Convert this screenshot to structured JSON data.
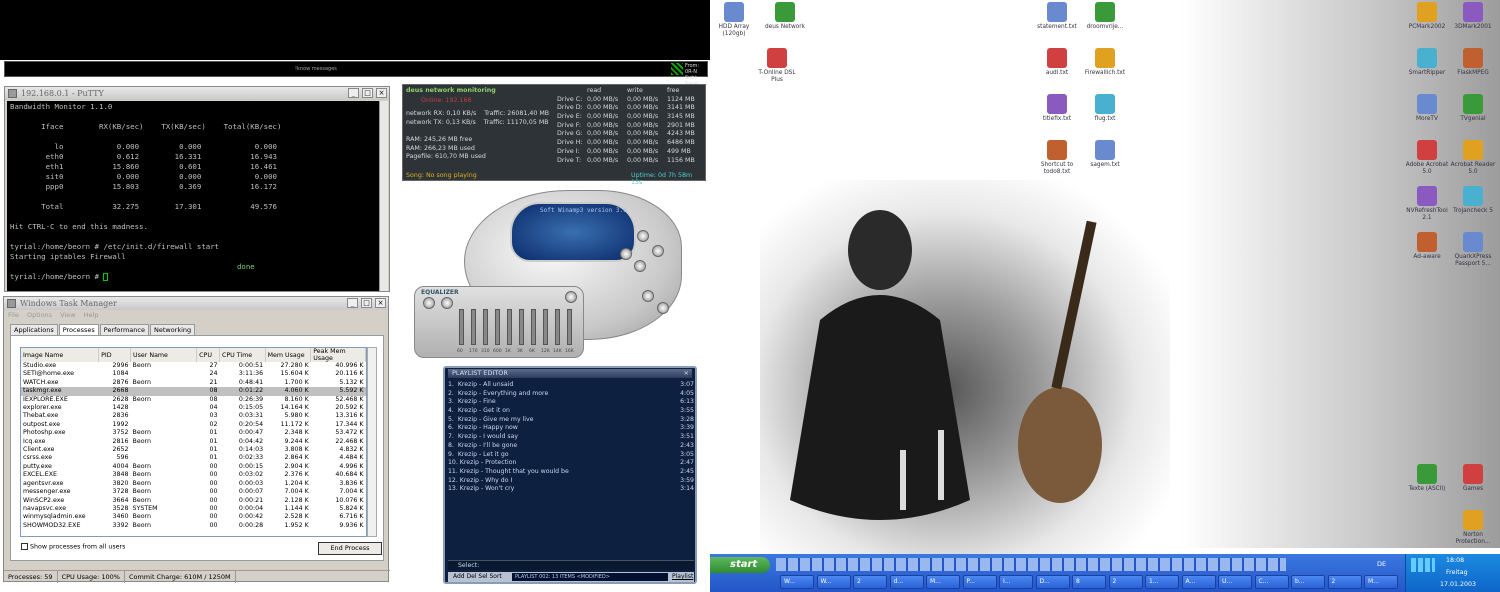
{
  "topbar": {
    "message": "!know messages",
    "from": "From: 0R-N",
    "subj": "Subj: Neue"
  },
  "putty": {
    "title": "192.168.0.1 - PuTTY",
    "lines": [
      "Bandwidth Monitor 1.1.0",
      "",
      "       Iface        RX(KB/sec)    TX(KB/sec)    Total(KB/sec)",
      "",
      "          lo            0.000         0.000            0.000",
      "        eth0            0.612        16.331           16.943",
      "        eth1           15.860         0.601           16.461",
      "        sit0            0.000         0.000            0.000",
      "        ppp0           15.803         0.369           16.172",
      "",
      "       Total           32.275        17.301           49.576",
      "",
      "Hit CTRL-C to end this madness.",
      "",
      "tyrial:/home/beorn # /etc/init.d/firewall start",
      "Starting iptables Firewall"
    ],
    "done": "done",
    "prompt": "tyrial:/home/beorn # "
  },
  "taskmgr": {
    "title": "Windows Task Manager",
    "menu": [
      "File",
      "Options",
      "View",
      "Help"
    ],
    "tabs": [
      "Applications",
      "Processes",
      "Performance",
      "Networking"
    ],
    "columns": [
      "Image Name",
      "PID",
      "User Name",
      "CPU",
      "CPU Time",
      "Mem Usage",
      "Peak Mem Usage"
    ],
    "rows": [
      [
        "Studio.exe",
        "2996",
        "Beorn",
        "27",
        "0:00:51",
        "27.280 K",
        "40.996 K"
      ],
      [
        "SETI@home.exe",
        "1084",
        "",
        "24",
        "3:11:36",
        "15.604 K",
        "20.116 K"
      ],
      [
        "WATCH.exe",
        "2876",
        "Beorn",
        "21",
        "0:48:41",
        "1.700 K",
        "5.132 K"
      ],
      [
        "taskmgr.exe",
        "2668",
        "",
        "08",
        "0:01:22",
        "4.060 K",
        "5.592 K"
      ],
      [
        "IEXPLORE.EXE",
        "2628",
        "Beorn",
        "08",
        "0:26:39",
        "8.160 K",
        "52.468 K"
      ],
      [
        "explorer.exe",
        "1428",
        "",
        "04",
        "0:15:05",
        "14.164 K",
        "20.592 K"
      ],
      [
        "Thebat.exe",
        "2836",
        "",
        "03",
        "0:03:31",
        "5.980 K",
        "13.316 K"
      ],
      [
        "outpost.exe",
        "1992",
        "",
        "02",
        "0:20:54",
        "11.172 K",
        "17.344 K"
      ],
      [
        "Photoshp.exe",
        "3752",
        "Beorn",
        "01",
        "0:00:47",
        "2.348 K",
        "53.472 K"
      ],
      [
        "Icq.exe",
        "2816",
        "Beorn",
        "01",
        "0:04:42",
        "9.244 K",
        "22.468 K"
      ],
      [
        "Client.exe",
        "2652",
        "",
        "01",
        "0:14:03",
        "3.808 K",
        "4.832 K"
      ],
      [
        "csrss.exe",
        "596",
        "",
        "01",
        "0:02:33",
        "2.864 K",
        "4.484 K"
      ],
      [
        "putty.exe",
        "4004",
        "Beorn",
        "00",
        "0:00:15",
        "2.904 K",
        "4.996 K"
      ],
      [
        "EXCEL.EXE",
        "3848",
        "Beorn",
        "00",
        "0:03:02",
        "2.376 K",
        "40.684 K"
      ],
      [
        "agentsvr.exe",
        "3820",
        "Beorn",
        "00",
        "0:00:03",
        "1.204 K",
        "3.836 K"
      ],
      [
        "messenger.exe",
        "3728",
        "Beorn",
        "00",
        "0:00:07",
        "7.004 K",
        "7.004 K"
      ],
      [
        "WinSCP2.exe",
        "3664",
        "Beorn",
        "00",
        "0:00:21",
        "2.128 K",
        "10.076 K"
      ],
      [
        "navapsvc.exe",
        "3528",
        "SYSTEM",
        "00",
        "0:00:04",
        "1.144 K",
        "5.824 K"
      ],
      [
        "winmysqladmin.exe",
        "3460",
        "Beorn",
        "00",
        "0:00:42",
        "2.528 K",
        "6.716 K"
      ],
      [
        "SHOWMOD32.EXE",
        "3392",
        "Beorn",
        "00",
        "0:00:28",
        "1.952 K",
        "9.936 K"
      ]
    ],
    "showall": "Show processes from all users",
    "endprocess": "End Process",
    "status": {
      "processes": "Processes: 59",
      "cpu": "CPU Usage: 100%",
      "commit": "Commit Charge: 610M / 1250M"
    }
  },
  "netmon": {
    "title": "deus network monitoring",
    "subtitle": "Online: 192.168",
    "left": [
      "network RX: 0,10 KB/s    Traffic: 26081,40 MB",
      "network TX: 0,13 KB/s    Traffic: 11170,05 MB",
      "",
      "RAM: 245,26 MB free",
      "RAM: 266,23 MB used",
      "Pagefile: 610,70 MB used"
    ],
    "headers": [
      "read",
      "write",
      "free"
    ],
    "drives": [
      [
        "Drive C:",
        "0,00 MB/s",
        "0,00 MB/s",
        "1124 MB"
      ],
      [
        "Drive D:",
        "0,00 MB/s",
        "0,00 MB/s",
        "3141 MB"
      ],
      [
        "Drive E:",
        "0,00 MB/s",
        "0,00 MB/s",
        "3145 MB"
      ],
      [
        "Drive F:",
        "0,00 MB/s",
        "0,00 MB/s",
        "2901 MB"
      ],
      [
        "Drive G:",
        "0,00 MB/s",
        "0,00 MB/s",
        "4243 MB"
      ],
      [
        "Drive H:",
        "0,00 MB/s",
        "0,00 MB/s",
        "6486 MB"
      ],
      [
        "Drive I:",
        "0,00 MB/s",
        "0,00 MB/s",
        "499 MB"
      ],
      [
        "Drive T:",
        "0,00 MB/s",
        "0,00 MB/s",
        "1156 MB"
      ]
    ],
    "song": "Song: No song playing",
    "uptime": "Uptime: 0d 7h 58m 13s"
  },
  "winamp": {
    "screen": "Soft Winamp3 version 3.0",
    "eq_label": "EQUALIZER",
    "eq_bands": [
      "60",
      "170",
      "310",
      "600",
      "1K",
      "3K",
      "6K",
      "12K",
      "14K",
      "16K"
    ]
  },
  "playlist": {
    "title": "PLAYLIST EDITOR",
    "items": [
      [
        "1.  Krezip - All unsaid",
        "3:07"
      ],
      [
        "2.  Krezip - Everything and more",
        "4:05"
      ],
      [
        "3.  Krezip - Fine",
        "6:13"
      ],
      [
        "4.  Krezip - Get it on",
        "3:55"
      ],
      [
        "5.  Krezip - Give me my live",
        "3:28"
      ],
      [
        "6.  Krezip - Happy now",
        "3:39"
      ],
      [
        "7.  Krezip - I would say",
        "3:51"
      ],
      [
        "8.  Krezip - I'll be gone",
        "2:43"
      ],
      [
        "9.  Krezip - Let it go",
        "3:05"
      ],
      [
        "10. Krezip - Protection",
        "2:47"
      ],
      [
        "11. Krezip - Thought that you would be",
        "2:45"
      ],
      [
        "12. Krezip - Why do I",
        "3:59"
      ],
      [
        "13. Krezip - Won't cry",
        "3:14"
      ]
    ],
    "select": "Select:",
    "buttons": "Add Del Sel Sort",
    "lcd": "PLAYLIST 002: 13 ITEMS <MODIFIED>",
    "tab": "Playlist"
  },
  "desktop": {
    "left_icons": [
      "HDD Array (120gb)",
      "deus Network",
      "T-Online DSL Plus"
    ],
    "mid_icons": [
      "statement.txt",
      "droomvrije...",
      "audi.txt",
      "Firewallich.txt",
      "titlefix.txt",
      "flug.txt",
      "Shortcut to todo8.txt",
      "sagem.txt"
    ],
    "right_icons": [
      "PCMark2002",
      "3DMark2001",
      "SmartRipper",
      "FlaskMPEG",
      "MoreTV",
      "TVgenial",
      "Adobe Acrobat 5.0",
      "Acrobat Reader 5.0",
      "NVRefreshTool 2.1",
      "Trojancheck 5",
      "Ad-aware",
      "QuarkXPress Passport 5...",
      "Texte (ASCII)",
      "Games",
      "Norton Protection..."
    ]
  },
  "taskbar": {
    "start": "start",
    "lang": "DE",
    "time": "18:08",
    "day": "Freitag",
    "date": "17.01.2003",
    "tasks": [
      "W...",
      "W...",
      "2",
      "d...",
      "M...",
      "P...",
      "I...",
      "D...",
      "8",
      "2",
      "1...",
      "A...",
      "U...",
      "C...",
      "b...",
      "2",
      "M..."
    ]
  }
}
